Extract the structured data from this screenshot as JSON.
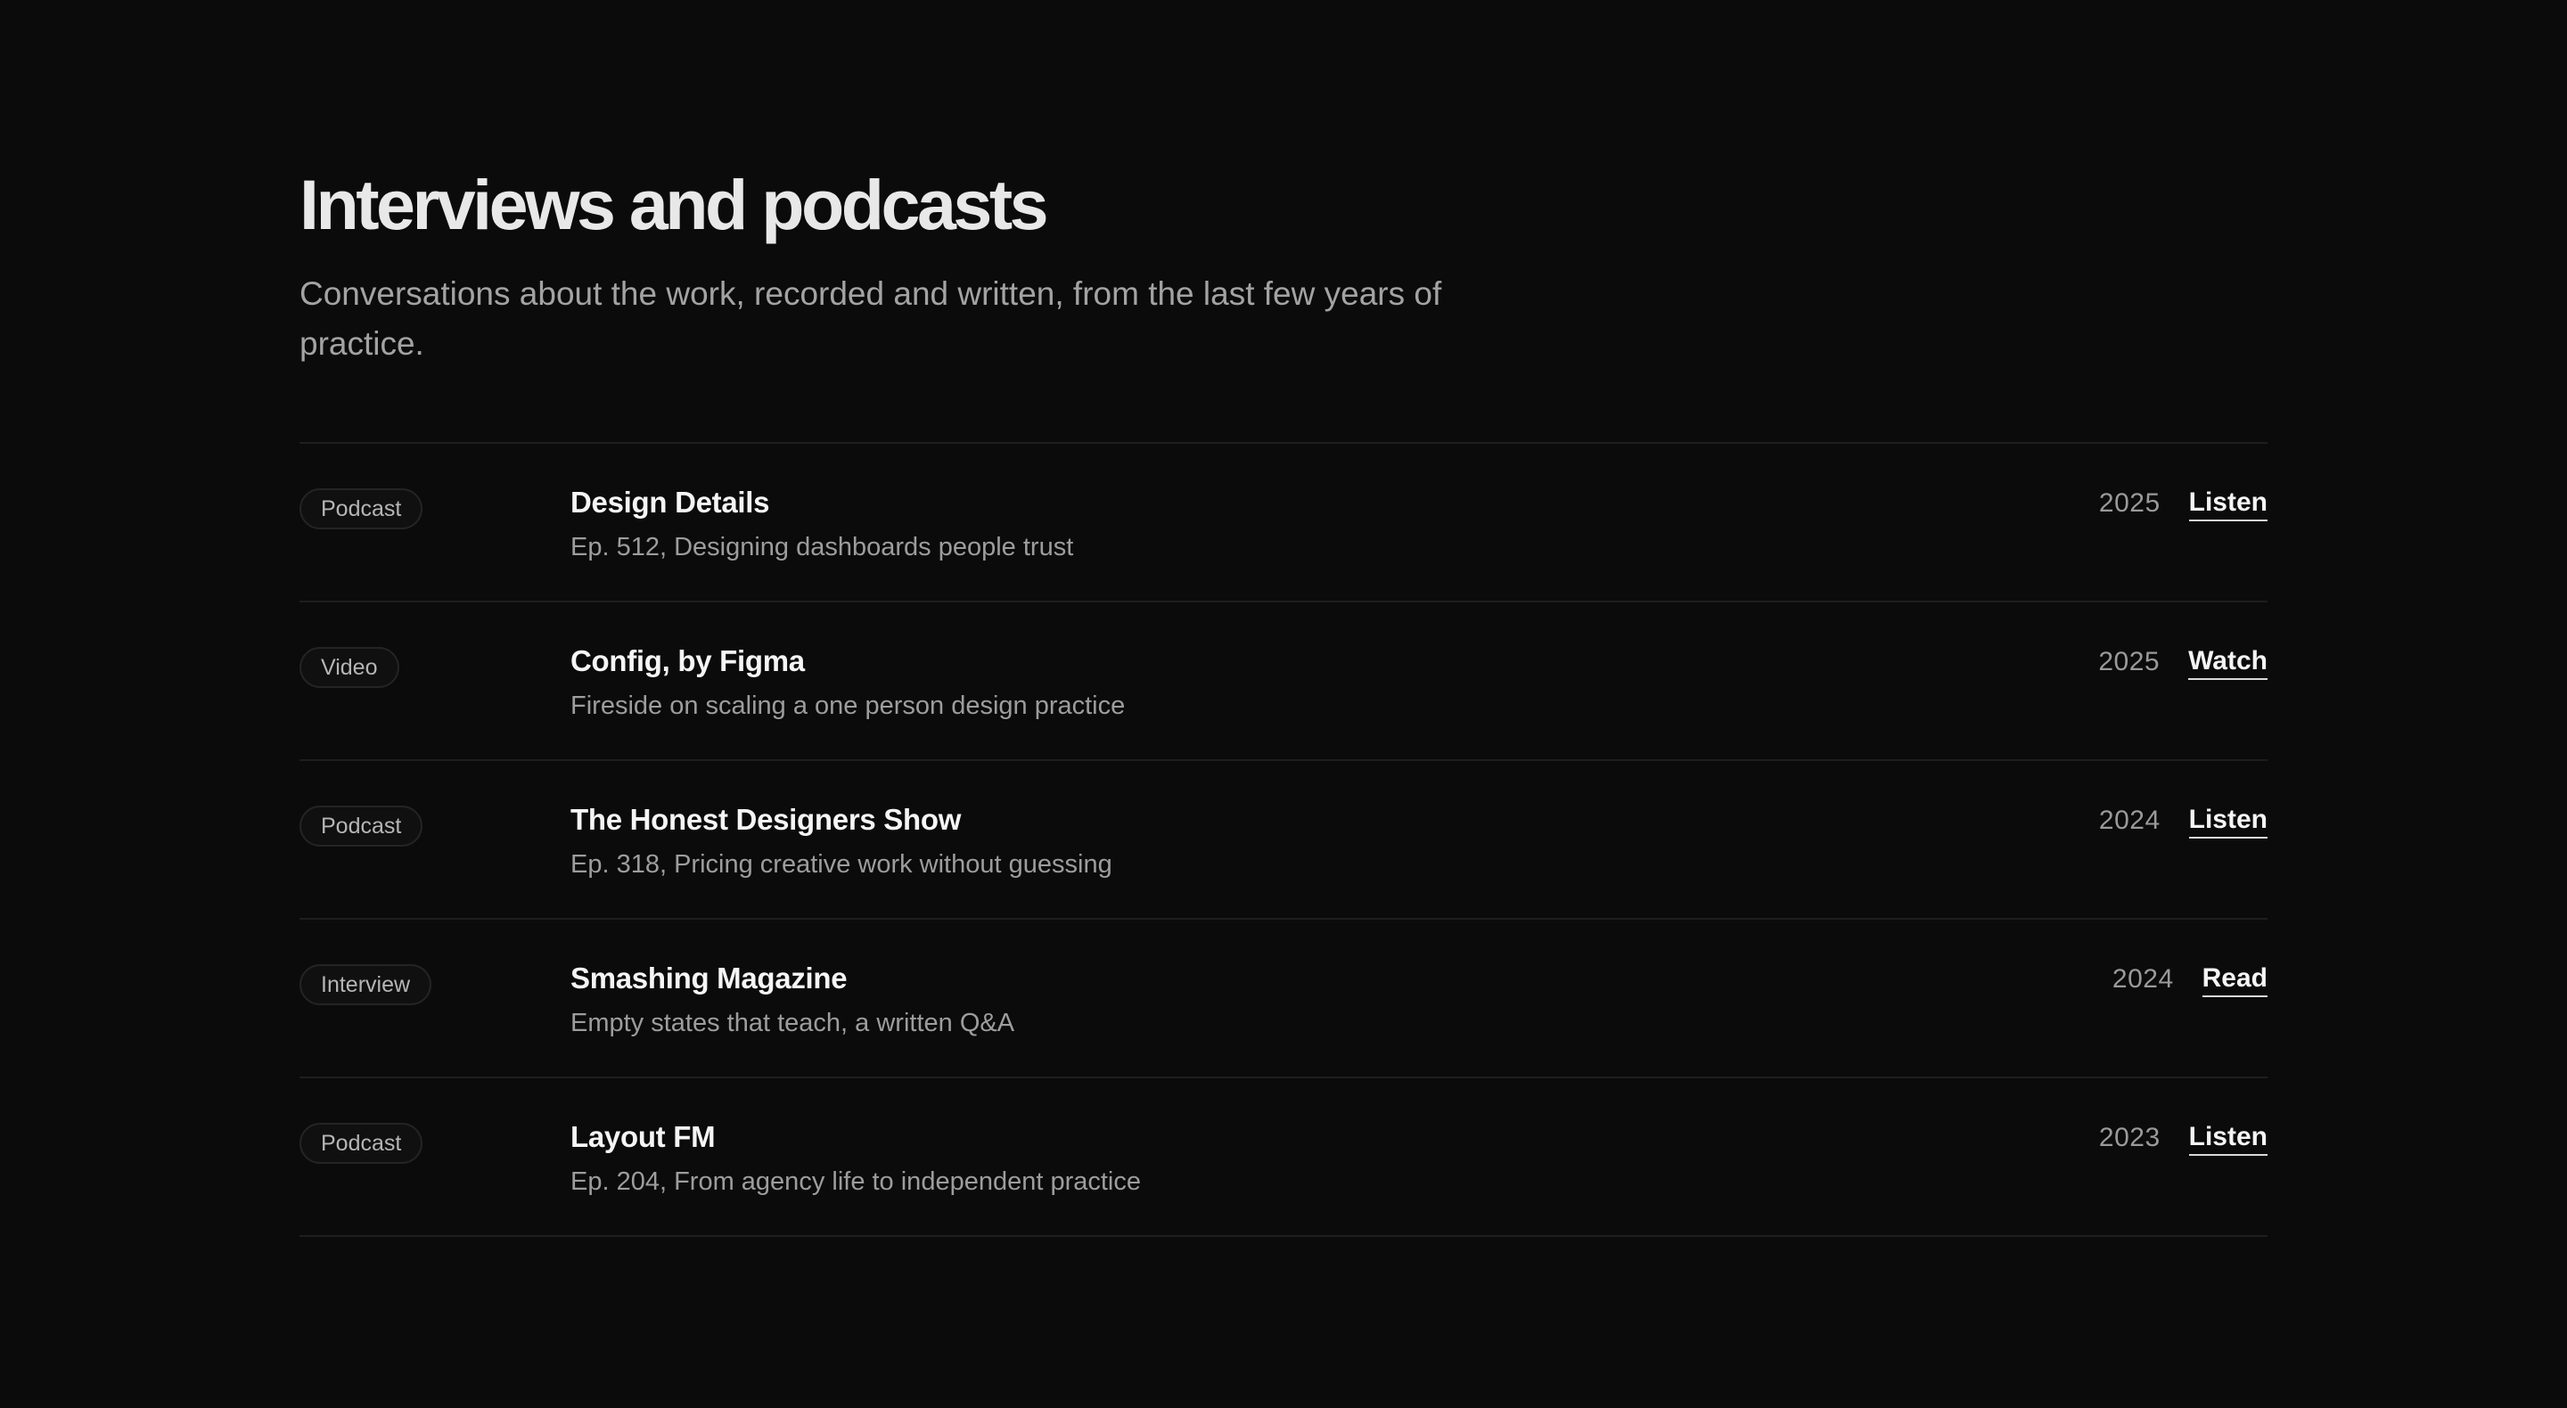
{
  "header": {
    "title": "Interviews and podcasts",
    "subtitle": "Conversations about the work, recorded and written, from the last few years of practice."
  },
  "items": [
    {
      "type": "Podcast",
      "title": "Design Details",
      "description": "Ep. 512, Designing dashboards people trust",
      "year": "2025",
      "action": "Listen"
    },
    {
      "type": "Video",
      "title": "Config, by Figma",
      "description": "Fireside on scaling a one person design practice",
      "year": "2025",
      "action": "Watch"
    },
    {
      "type": "Podcast",
      "title": "The Honest Designers Show",
      "description": "Ep. 318, Pricing creative work without guessing",
      "year": "2024",
      "action": "Listen"
    },
    {
      "type": "Interview",
      "title": "Smashing Magazine",
      "description": "Empty states that teach, a written Q&A",
      "year": "2024",
      "action": "Read"
    },
    {
      "type": "Podcast",
      "title": "Layout FM",
      "description": "Ep. 204, From agency life to independent practice",
      "year": "2023",
      "action": "Listen"
    }
  ],
  "colors": {
    "background": "#0b0b0b",
    "title": "#e8e8e8",
    "muted": "#a3a3a3",
    "divider": "#1e1e1e"
  }
}
